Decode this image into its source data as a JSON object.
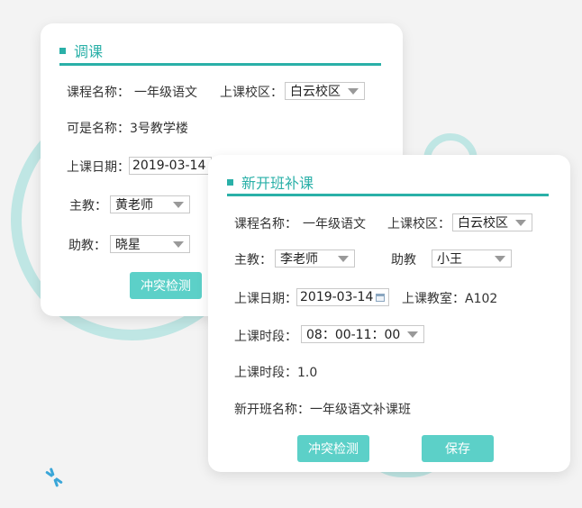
{
  "card1": {
    "title": "调课",
    "course_label": "课程名称：",
    "course_value": "一年级语文",
    "campus_label": "上课校区：",
    "campus_value": "白云校区",
    "alt_name_text": "可是名称：3号教学楼",
    "date_label": "上课日期：",
    "date_value": "2019-03-14",
    "teacher_label": "主教：",
    "teacher_value": "黄老师",
    "assistant_label": "助教：",
    "assistant_value": "晓星",
    "check_button": "冲突检测"
  },
  "card2": {
    "title": "新开班补课",
    "course_label": "课程名称：",
    "course_value": "一年级语文",
    "campus_label": "上课校区：",
    "campus_value": "白云校区",
    "teacher_label": "主教：",
    "teacher_value": "李老师",
    "assistant_label": "助教",
    "assistant_value": "小王",
    "date_label": "上课日期：",
    "date_value": "2019-03-14",
    "room_text": "上课教室：A102",
    "period_label": "上课时段：",
    "period_value": "08：00-11：00",
    "period_duration_text": "上课时段：1.0",
    "class_name_text": "新开班名称：一年级语文补课班",
    "check_button": "冲突检测",
    "save_button": "保存"
  },
  "colors": {
    "accent": "#2ab0a8",
    "button": "#5cd0c8",
    "ring": "#bfe6e4"
  }
}
